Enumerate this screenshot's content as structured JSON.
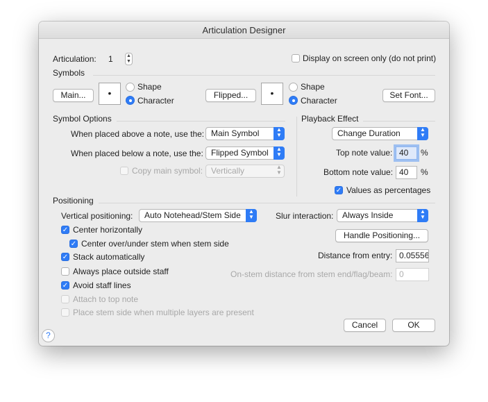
{
  "window": {
    "title": "Articulation Designer"
  },
  "articulation": {
    "label": "Articulation:",
    "value": "1"
  },
  "display_only": {
    "label": "Display on screen only (do not print)",
    "checked": false
  },
  "symbols": {
    "heading": "Symbols",
    "main_button": "Main...",
    "main_preview": "•",
    "flipped_button": "Flipped...",
    "flipped_preview": "•",
    "shape_label": "Shape",
    "character_label": "Character",
    "set_font_button": "Set Font..."
  },
  "symbol_options": {
    "heading": "Symbol Options",
    "above_label": "When placed above a note, use the:",
    "above_value": "Main Symbol",
    "below_label": "When placed below a note, use the:",
    "below_value": "Flipped Symbol",
    "copy_label": "Copy main symbol:",
    "copy_value": "Vertically"
  },
  "playback": {
    "heading": "Playback Effect",
    "effect_value": "Change Duration",
    "top_label": "Top note value:",
    "top_value": "40",
    "bottom_label": "Bottom note value:",
    "bottom_value": "40",
    "percent": "%",
    "values_pct_label": "Values as percentages"
  },
  "positioning": {
    "heading": "Positioning",
    "vertical_label": "Vertical positioning:",
    "vertical_value": "Auto Notehead/Stem Side",
    "slur_label": "Slur interaction:",
    "slur_value": "Always Inside",
    "center_h": "Center horizontally",
    "center_stem": "Center over/under stem when stem side",
    "stack": "Stack automatically",
    "outside": "Always place outside staff",
    "avoid": "Avoid staff lines",
    "attach": "Attach to top note",
    "stem_side": "Place stem side when multiple layers are present",
    "handle_button": "Handle Positioning...",
    "distance_label": "Distance from entry:",
    "distance_value": "0.05556",
    "onstem_label": "On-stem distance from stem end/flag/beam:",
    "onstem_value": "0"
  },
  "footer": {
    "cancel": "Cancel",
    "ok": "OK",
    "help": "?"
  },
  "colors": {
    "accent": "#2f7cf6",
    "dialog_bg": "#ececec"
  }
}
